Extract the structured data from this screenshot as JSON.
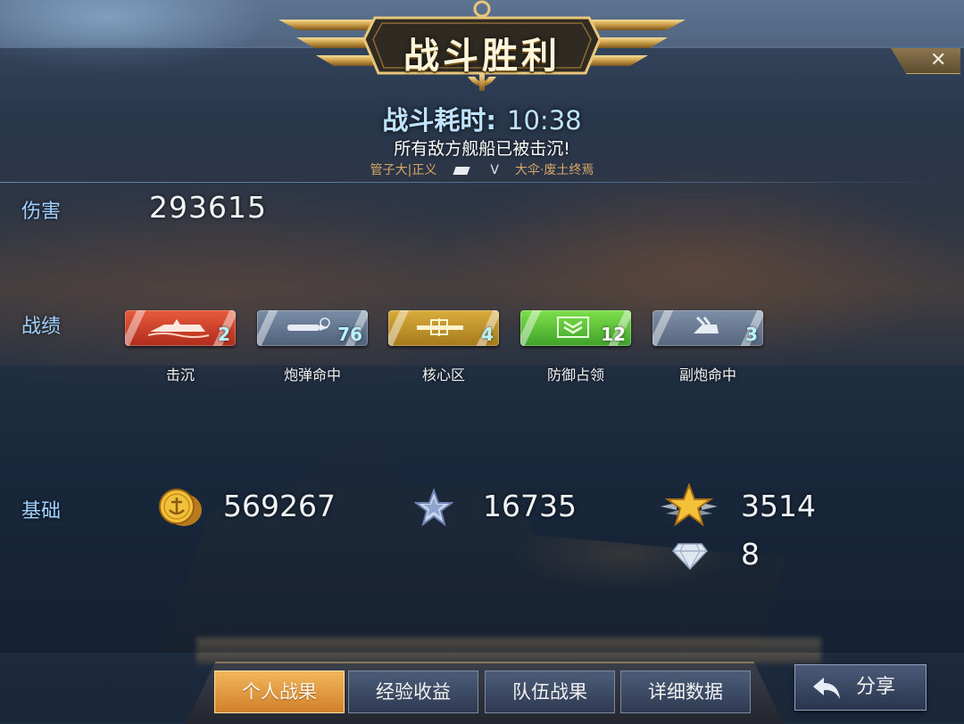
{
  "header": {
    "title": "战斗胜利",
    "battle_time_label": "战斗耗时:",
    "battle_time_value": "10:38",
    "result_message": "所有敌方舰船已被击沉!",
    "player_name": "管子大|正义",
    "vs": "V",
    "enemy_name": "大伞·废土终焉",
    "close_icon": "close-icon"
  },
  "stats": {
    "damage_label": "伤害",
    "damage_value": "293615",
    "record_label": "战绩",
    "achievements": [
      {
        "label": "击沉",
        "count": "2",
        "icon": "sinking-ship-icon",
        "color": "#d9402a"
      },
      {
        "label": "炮弹命中",
        "count": "76",
        "icon": "shell-hit-icon",
        "color": "#6c7f99"
      },
      {
        "label": "核心区",
        "count": "4",
        "icon": "core-zone-icon",
        "color": "#c99a30"
      },
      {
        "label": "防御占领",
        "count": "12",
        "icon": "defense-capture-icon",
        "color": "#62c73a"
      },
      {
        "label": "副炮命中",
        "count": "3",
        "icon": "secondary-gun-icon",
        "color": "#6e8099"
      }
    ],
    "base_label": "基础",
    "base_rewards": {
      "coins": "569267",
      "experience": "16735",
      "rank_points": "3514",
      "diamonds": "8"
    }
  },
  "tabs": [
    {
      "label": "个人战果",
      "active": true
    },
    {
      "label": "经验收益",
      "active": false
    },
    {
      "label": "队伍战果",
      "active": false
    },
    {
      "label": "详细数据",
      "active": false
    }
  ],
  "share_button": {
    "label": "分享",
    "icon": "share-back-arrow-icon"
  },
  "colors": {
    "accent_blue": "#9fd0ff",
    "gold": "#d9a766",
    "active_tab": "#e39a42"
  }
}
